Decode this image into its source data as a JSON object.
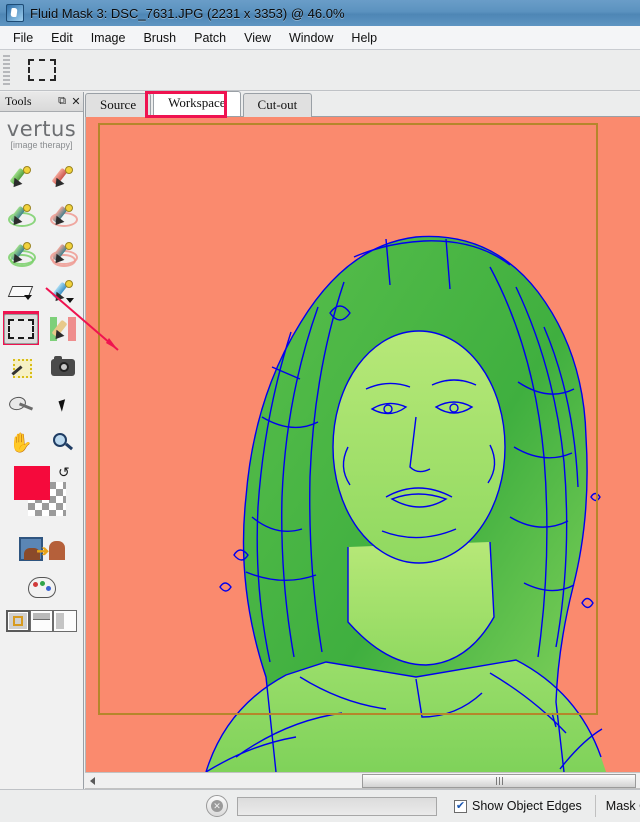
{
  "window": {
    "title": "Fluid Mask 3: DSC_7631.JPG (2231 x 3353) @ 46.0%",
    "app_icon": "app-logo-icon"
  },
  "menubar": {
    "items": [
      {
        "label": "File"
      },
      {
        "label": "Edit"
      },
      {
        "label": "Image"
      },
      {
        "label": "Brush"
      },
      {
        "label": "Patch"
      },
      {
        "label": "View"
      },
      {
        "label": "Window"
      },
      {
        "label": "Help"
      }
    ]
  },
  "options_bar": {
    "grip": "drag-handle-icon",
    "active_tool_icon": "marquee-rectangle-icon"
  },
  "tools_panel": {
    "title": "Tools",
    "restore_icon": "restore-window-icon",
    "close_icon": "close-icon",
    "brand_name": "vertus",
    "brand_tagline": "[image therapy]",
    "tools": [
      {
        "name": "keep-brush-tool",
        "icon": "green-pen-icon"
      },
      {
        "name": "delete-brush-tool",
        "icon": "red-pen-icon"
      },
      {
        "name": "keep-wide-brush-tool",
        "icon": "green-pen-rings-icon"
      },
      {
        "name": "delete-wide-brush-tool",
        "icon": "red-pen-rings-icon"
      },
      {
        "name": "keep-local-brush-tool",
        "icon": "green-pen-spiral-icon"
      },
      {
        "name": "delete-local-brush-tool",
        "icon": "red-pen-spiral-icon"
      },
      {
        "name": "eraser-tool",
        "icon": "eraser-icon"
      },
      {
        "name": "blend-brush-tool",
        "icon": "blue-pen-icon"
      },
      {
        "name": "marquee-select-tool",
        "icon": "marquee-rectangle-icon",
        "selected": true
      },
      {
        "name": "pen-path-tool",
        "icon": "fountain-pen-icon"
      },
      {
        "name": "magic-wand-tool",
        "icon": "magic-wand-icon"
      },
      {
        "name": "snapshot-tool",
        "icon": "camera-icon"
      },
      {
        "name": "blend-spoon-tool",
        "icon": "spoon-icon"
      },
      {
        "name": "pointer-tool",
        "icon": "arrow-cursor-icon"
      },
      {
        "name": "hand-tool",
        "icon": "hand-icon"
      },
      {
        "name": "zoom-tool",
        "icon": "magnifier-icon"
      }
    ],
    "foreground_color": "#f50a3c",
    "swap_icon": "swap-colors-icon",
    "image_transfer_icon": "image-transfer-icon",
    "palette_icon": "color-palette-icon",
    "view_modes": [
      {
        "name": "single-view-mode",
        "active": true
      },
      {
        "name": "split-horizontal-view-mode",
        "active": false
      },
      {
        "name": "split-vertical-view-mode",
        "active": false
      }
    ]
  },
  "tabs": [
    {
      "label": "Source",
      "active": false
    },
    {
      "label": "Workspace",
      "active": true,
      "highlighted": true
    },
    {
      "label": "Cut-out",
      "active": false
    }
  ],
  "canvas": {
    "background_color": "#fa8a6e",
    "mask_color_dark": "#3faf3f",
    "mask_color_light": "#a5e06a",
    "edge_color": "#0000ee",
    "selection_rect_color": "#b5862b",
    "annotation_arrow_color": "#ef1350"
  },
  "scrollbar": {
    "left_arrow_icon": "chevron-left-icon",
    "thumb_grip_icon": "grip-icon"
  },
  "statusbar": {
    "stop_icon": "stop-cancel-icon",
    "progress_value": "",
    "show_object_edges": {
      "label": "Show Object Edges",
      "checked": true,
      "tick": "✔"
    },
    "mask_option_label": "Mask O"
  }
}
